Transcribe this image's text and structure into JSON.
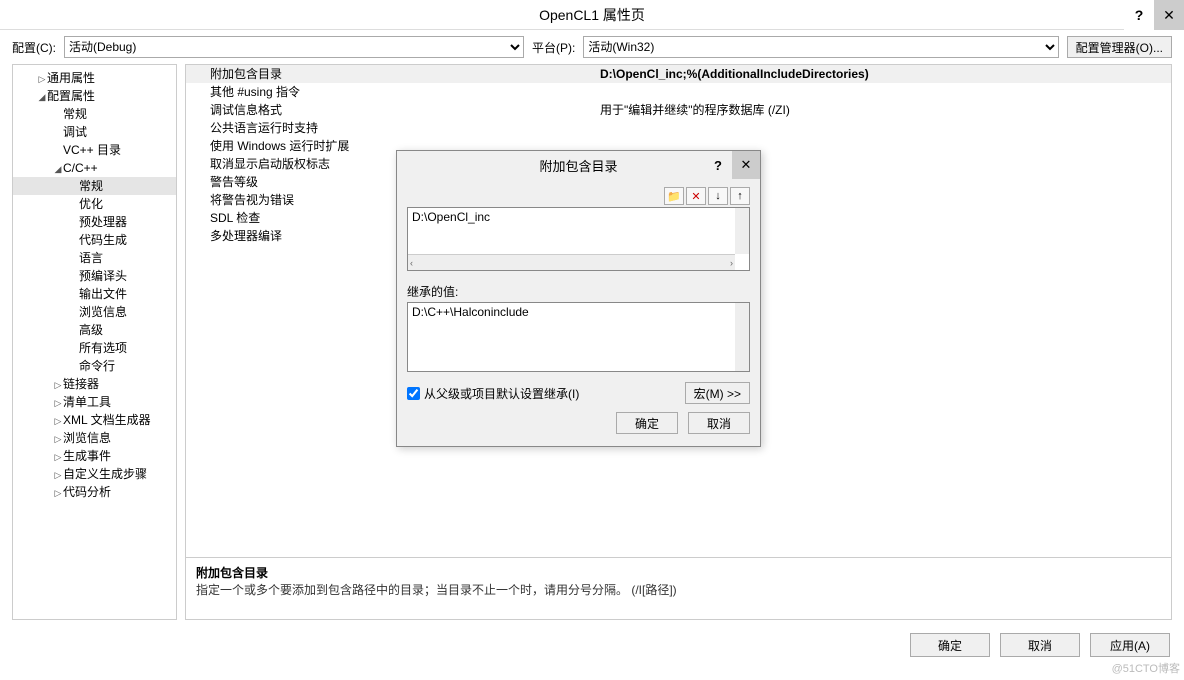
{
  "titlebar": {
    "title": "OpenCL1 属性页",
    "help": "?",
    "close": "✕"
  },
  "toolbar": {
    "config_label": "配置(C):",
    "config_value": "活动(Debug)",
    "platform_label": "平台(P):",
    "platform_value": "活动(Win32)",
    "config_mgr": "配置管理器(O)..."
  },
  "tree": [
    {
      "label": "通用属性",
      "indent": 1,
      "arrow": "▷"
    },
    {
      "label": "配置属性",
      "indent": 1,
      "arrow": "◢"
    },
    {
      "label": "常规",
      "indent": 2,
      "arrow": ""
    },
    {
      "label": "调试",
      "indent": 2,
      "arrow": ""
    },
    {
      "label": "VC++ 目录",
      "indent": 2,
      "arrow": ""
    },
    {
      "label": "C/C++",
      "indent": 2,
      "arrow": "◢"
    },
    {
      "label": "常规",
      "indent": 3,
      "arrow": "",
      "selected": true
    },
    {
      "label": "优化",
      "indent": 3,
      "arrow": ""
    },
    {
      "label": "预处理器",
      "indent": 3,
      "arrow": ""
    },
    {
      "label": "代码生成",
      "indent": 3,
      "arrow": ""
    },
    {
      "label": "语言",
      "indent": 3,
      "arrow": ""
    },
    {
      "label": "预编译头",
      "indent": 3,
      "arrow": ""
    },
    {
      "label": "输出文件",
      "indent": 3,
      "arrow": ""
    },
    {
      "label": "浏览信息",
      "indent": 3,
      "arrow": ""
    },
    {
      "label": "高级",
      "indent": 3,
      "arrow": ""
    },
    {
      "label": "所有选项",
      "indent": 3,
      "arrow": ""
    },
    {
      "label": "命令行",
      "indent": 3,
      "arrow": ""
    },
    {
      "label": "链接器",
      "indent": 2,
      "arrow": "▷"
    },
    {
      "label": "清单工具",
      "indent": 2,
      "arrow": "▷"
    },
    {
      "label": "XML 文档生成器",
      "indent": 2,
      "arrow": "▷"
    },
    {
      "label": "浏览信息",
      "indent": 2,
      "arrow": "▷"
    },
    {
      "label": "生成事件",
      "indent": 2,
      "arrow": "▷"
    },
    {
      "label": "自定义生成步骤",
      "indent": 2,
      "arrow": "▷"
    },
    {
      "label": "代码分析",
      "indent": 2,
      "arrow": "▷"
    }
  ],
  "props": [
    {
      "name": "附加包含目录",
      "value": "D:\\OpenCl_inc;%(AdditionalIncludeDirectories)",
      "highlight": true,
      "bold": true
    },
    {
      "name": "其他 #using 指令",
      "value": ""
    },
    {
      "name": "调试信息格式",
      "value": "用于\"编辑并继续\"的程序数据库 (/ZI)"
    },
    {
      "name": "公共语言运行时支持",
      "value": ""
    },
    {
      "name": "使用 Windows 运行时扩展",
      "value": ""
    },
    {
      "name": "取消显示启动版权标志",
      "value": ""
    },
    {
      "name": "警告等级",
      "value": ""
    },
    {
      "name": "将警告视为错误",
      "value": ""
    },
    {
      "name": "SDL 检查",
      "value": ""
    },
    {
      "name": "多处理器编译",
      "value": ""
    }
  ],
  "desc": {
    "title": "附加包含目录",
    "text": "指定一个或多个要添加到包含路径中的目录；当目录不止一个时，请用分号分隔。          (/I[路径])"
  },
  "buttons": {
    "ok": "确定",
    "cancel": "取消",
    "apply": "应用(A)"
  },
  "dialog": {
    "title": "附加包含目录",
    "help": "?",
    "close": "✕",
    "items": [
      "D:\\OpenCl_inc"
    ],
    "scroll_left": "‹",
    "scroll_right": "›",
    "inherited_label": "继承的值:",
    "inherited": [
      "D:\\C++\\Halconinclude"
    ],
    "inherit_chk": "从父级或项目默认设置继承(I)",
    "inherit_checked": true,
    "macro_btn": "宏(M) >>",
    "ok": "确定",
    "cancel": "取消",
    "icons": {
      "folder": "📁",
      "delete": "✕",
      "down": "↓",
      "up": "↑"
    }
  },
  "watermark": "@51CTO博客"
}
